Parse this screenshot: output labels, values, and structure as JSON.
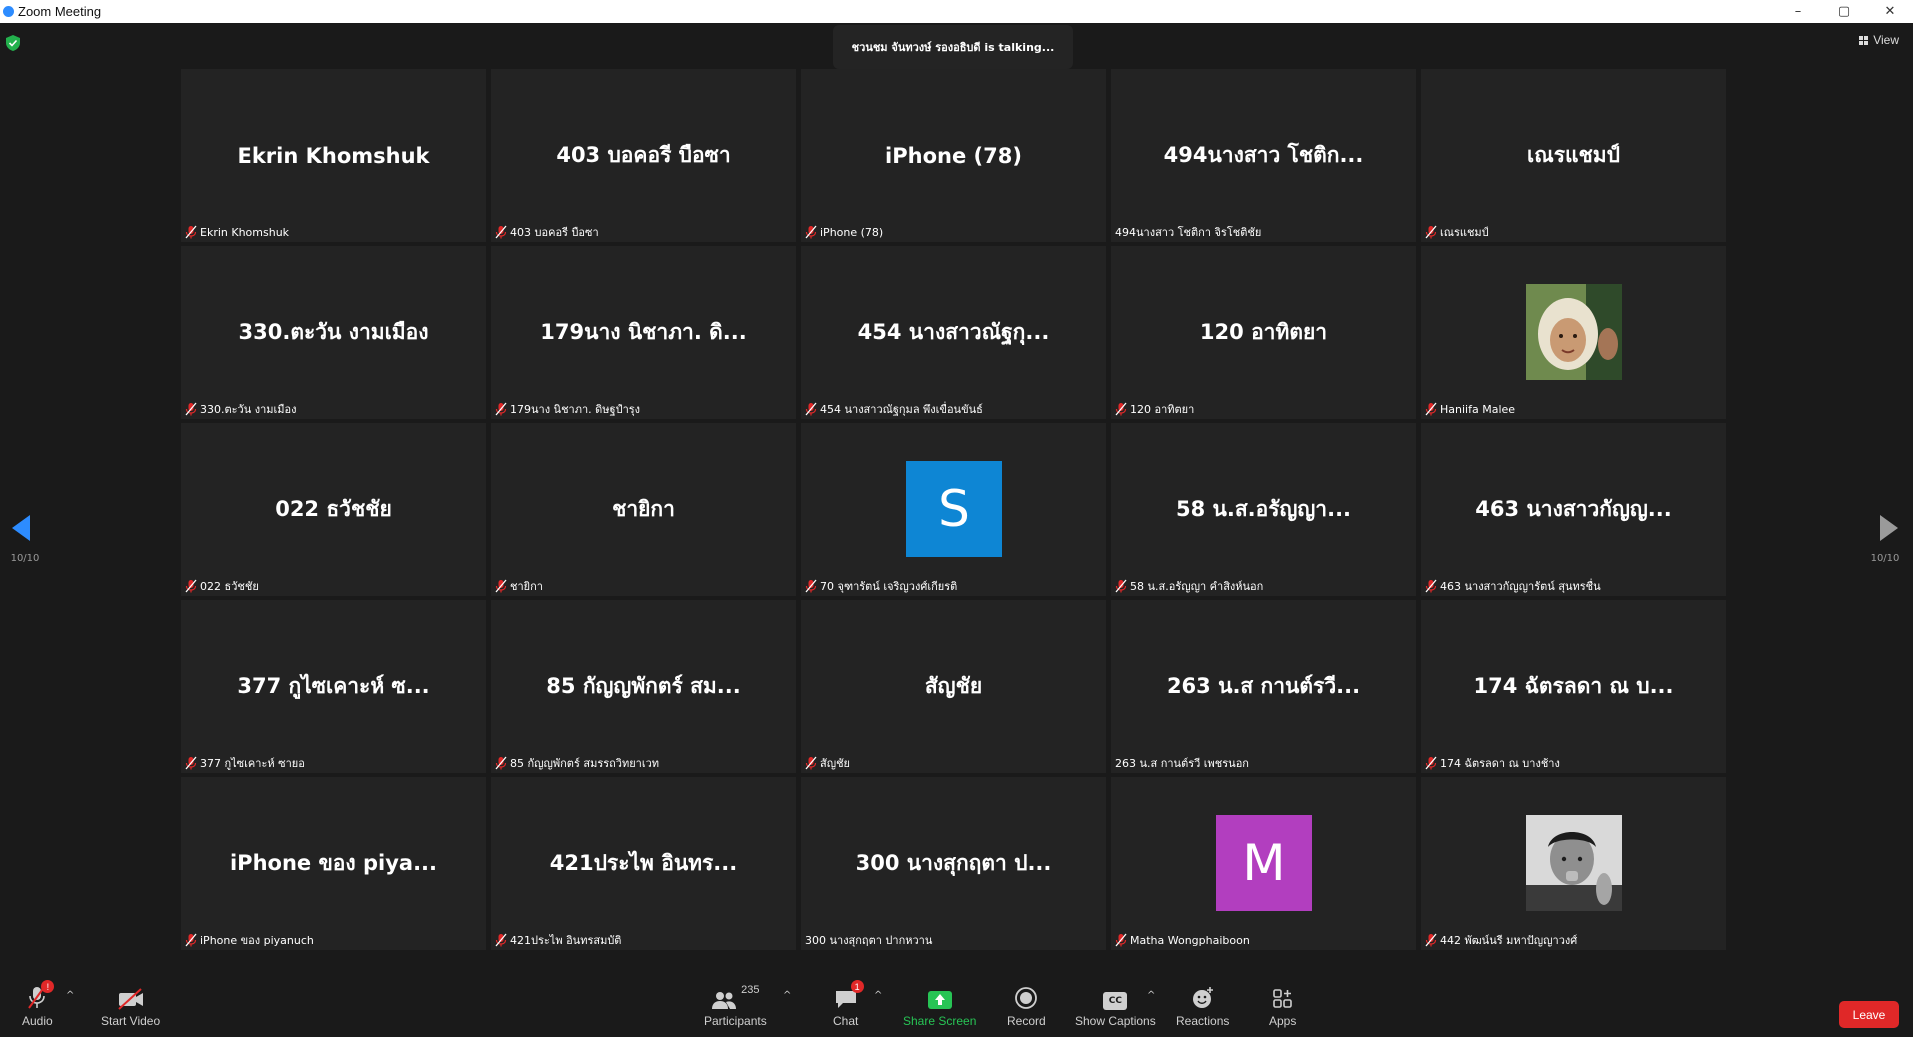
{
  "window": {
    "title": "Zoom Meeting",
    "controls": [
      "–",
      "▢",
      "✕"
    ]
  },
  "header": {
    "talking_text": "ชวนชม จันทวงษ์ รองอธิบดี is  talking...",
    "view_label": "View"
  },
  "nav": {
    "left_count": "10/10",
    "right_count": "10/10"
  },
  "tiles": [
    {
      "display": "Ekrin Khomshuk",
      "label": "Ekrin Khomshuk",
      "muted": true
    },
    {
      "display": "403 บอคอรี  บือซา",
      "label": "403 บอคอรี  บือซา",
      "muted": true
    },
    {
      "display": "iPhone (78)",
      "label": "iPhone (78)",
      "muted": true
    },
    {
      "display": "494นางสาว โชติก...",
      "label": "494นางสาว โชติกา จิรโชติชัย",
      "muted": false
    },
    {
      "display": "เณรแชมป์",
      "label": "เณรแชมป์",
      "muted": true
    },
    {
      "display": "330.ตะวัน งามเมือง",
      "label": "330.ตะวัน งามเมือง",
      "muted": true
    },
    {
      "display": "179นาง นิชาภา. ดิ...",
      "label": "179นาง นิชาภา. ดิษฐปำรุง",
      "muted": true
    },
    {
      "display": "454 นางสาวณัฐกุ...",
      "label": "454 นางสาวณัฐกุมล พึงเขื่อนขันธ์",
      "muted": true
    },
    {
      "display": "120 อาทิตยา",
      "label": "120 อาทิตยา",
      "muted": true
    },
    {
      "display": "",
      "label": "Haniifa Malee",
      "muted": true
    },
    {
      "display": "022 ธวัชชัย",
      "label": "022 ธวัชชัย",
      "muted": true
    },
    {
      "display": "ชายิกา",
      "label": "ชายิกา",
      "muted": true
    },
    {
      "display": "",
      "label": "70 จุฑารัตน์ เจริญวงศ์เกียรติ",
      "muted": true,
      "avatar": "S",
      "avatar_color": "#0e86d4"
    },
    {
      "display": "58 น.ส.อรัญญา...",
      "label": "58 น.ส.อรัญญา คำสิงห์นอก",
      "muted": true
    },
    {
      "display": "463 นางสาวกัญญ...",
      "label": "463 นางสาวกัญญารัตน์ สุนทรชื่น",
      "muted": true
    },
    {
      "display": "377 กูไซเคาะห์ ซ...",
      "label": "377 กูไซเคาะห์ ซายอ",
      "muted": true
    },
    {
      "display": "85 กัญญพักตร์ สม...",
      "label": "85 กัญญพักตร์ สมรรถวิทยาเวท",
      "muted": true
    },
    {
      "display": "สัญชัย",
      "label": "สัญชัย",
      "muted": true
    },
    {
      "display": "263 น.ส กานต์รวี...",
      "label": "263 น.ส กานต์รวี เพชรนอก",
      "muted": false
    },
    {
      "display": "174 ฉัตรลดา ณ บ...",
      "label": "174 ฉัตรลดา ณ บางช้าง",
      "muted": true
    },
    {
      "display": "iPhone ของ piya...",
      "label": "iPhone ของ piyanuch",
      "muted": true
    },
    {
      "display": "421ประไพ อินทร...",
      "label": "421ประไพ อินทรสมบัติ",
      "muted": true
    },
    {
      "display": "300 นางสุกฤตา ป...",
      "label": "300 นางสุกฤตา ปากหวาน",
      "muted": false
    },
    {
      "display": "",
      "label": "Matha Wongphaiboon",
      "muted": true,
      "avatar": "M",
      "avatar_color": "#b23ebf"
    },
    {
      "display": "",
      "label": "442 พัฒน์นรี มหาปัญญาวงศ์",
      "muted": true
    }
  ],
  "toolbar": {
    "audio": "Audio",
    "audio_badge": "!",
    "start_video": "Start Video",
    "participants": "Participants",
    "participants_count": "235",
    "chat": "Chat",
    "chat_badge": "1",
    "share_screen": "Share Screen",
    "record": "Record",
    "show_captions": "Show Captions",
    "cc": "CC",
    "reactions": "Reactions",
    "apps": "Apps",
    "leave": "Leave"
  },
  "colors": {
    "accent_green": "#27c455",
    "leave_red": "#e02828",
    "tile_bg": "#232323",
    "stage_bg": "#1a1a1a"
  }
}
